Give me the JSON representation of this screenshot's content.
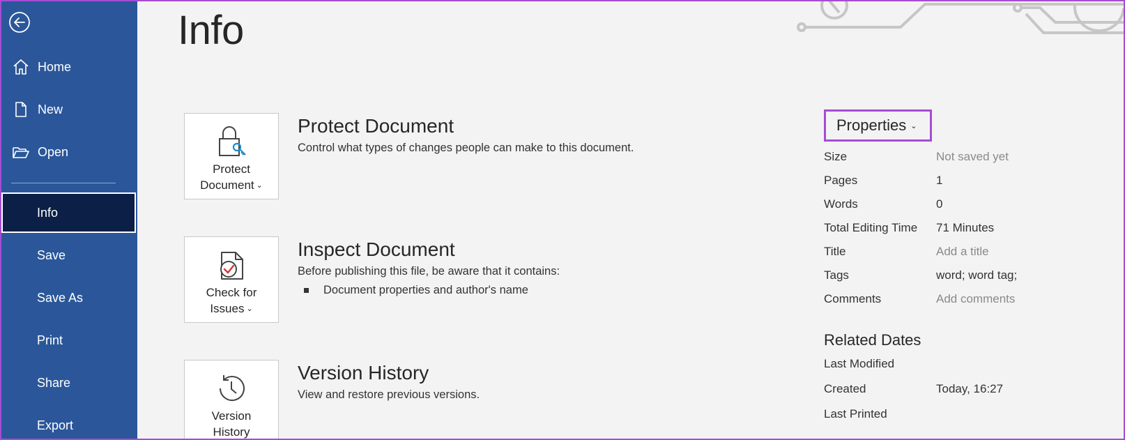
{
  "sidebar": {
    "items": [
      {
        "label": "Home",
        "icon": "home-icon"
      },
      {
        "label": "New",
        "icon": "new-document-icon"
      },
      {
        "label": "Open",
        "icon": "folder-open-icon"
      },
      {
        "label": "Info"
      },
      {
        "label": "Save"
      },
      {
        "label": "Save As"
      },
      {
        "label": "Print"
      },
      {
        "label": "Share"
      },
      {
        "label": "Export"
      }
    ],
    "active": "Info"
  },
  "page": {
    "title": "Info"
  },
  "sections": [
    {
      "button_label_1": "Protect",
      "button_label_2": "Document",
      "icon": "lock-key-icon",
      "heading": "Protect Document",
      "description": "Control what types of changes people can make to this document."
    },
    {
      "button_label_1": "Check for",
      "button_label_2": "Issues",
      "icon": "inspect-document-icon",
      "heading": "Inspect Document",
      "description": "Before publishing this file, be aware that it contains:",
      "bullets": [
        "Document properties and author's name"
      ]
    },
    {
      "button_label_1": "Version",
      "button_label_2": "History",
      "icon": "history-clock-icon",
      "heading": "Version History",
      "description": "View and restore previous versions."
    }
  ],
  "properties": {
    "header": "Properties",
    "rows": [
      {
        "key": "Size",
        "value": "Not saved yet",
        "muted": true
      },
      {
        "key": "Pages",
        "value": "1"
      },
      {
        "key": "Words",
        "value": "0"
      },
      {
        "key": "Total Editing Time",
        "value": "71 Minutes"
      },
      {
        "key": "Title",
        "value": "Add a title",
        "muted": true
      },
      {
        "key": "Tags",
        "value": "word; word tag;"
      },
      {
        "key": "Comments",
        "value": "Add comments",
        "muted": true
      }
    ]
  },
  "related_dates": {
    "header": "Related Dates",
    "rows": [
      {
        "key": "Last Modified",
        "value": ""
      },
      {
        "key": "Created",
        "value": "Today, 16:27"
      },
      {
        "key": "Last Printed",
        "value": ""
      }
    ]
  },
  "colors": {
    "sidebar_bg": "#2b579a",
    "sidebar_active_bg": "#0b1f47",
    "highlight_outline": "#a64cd4",
    "background": "#f3f3f3"
  }
}
